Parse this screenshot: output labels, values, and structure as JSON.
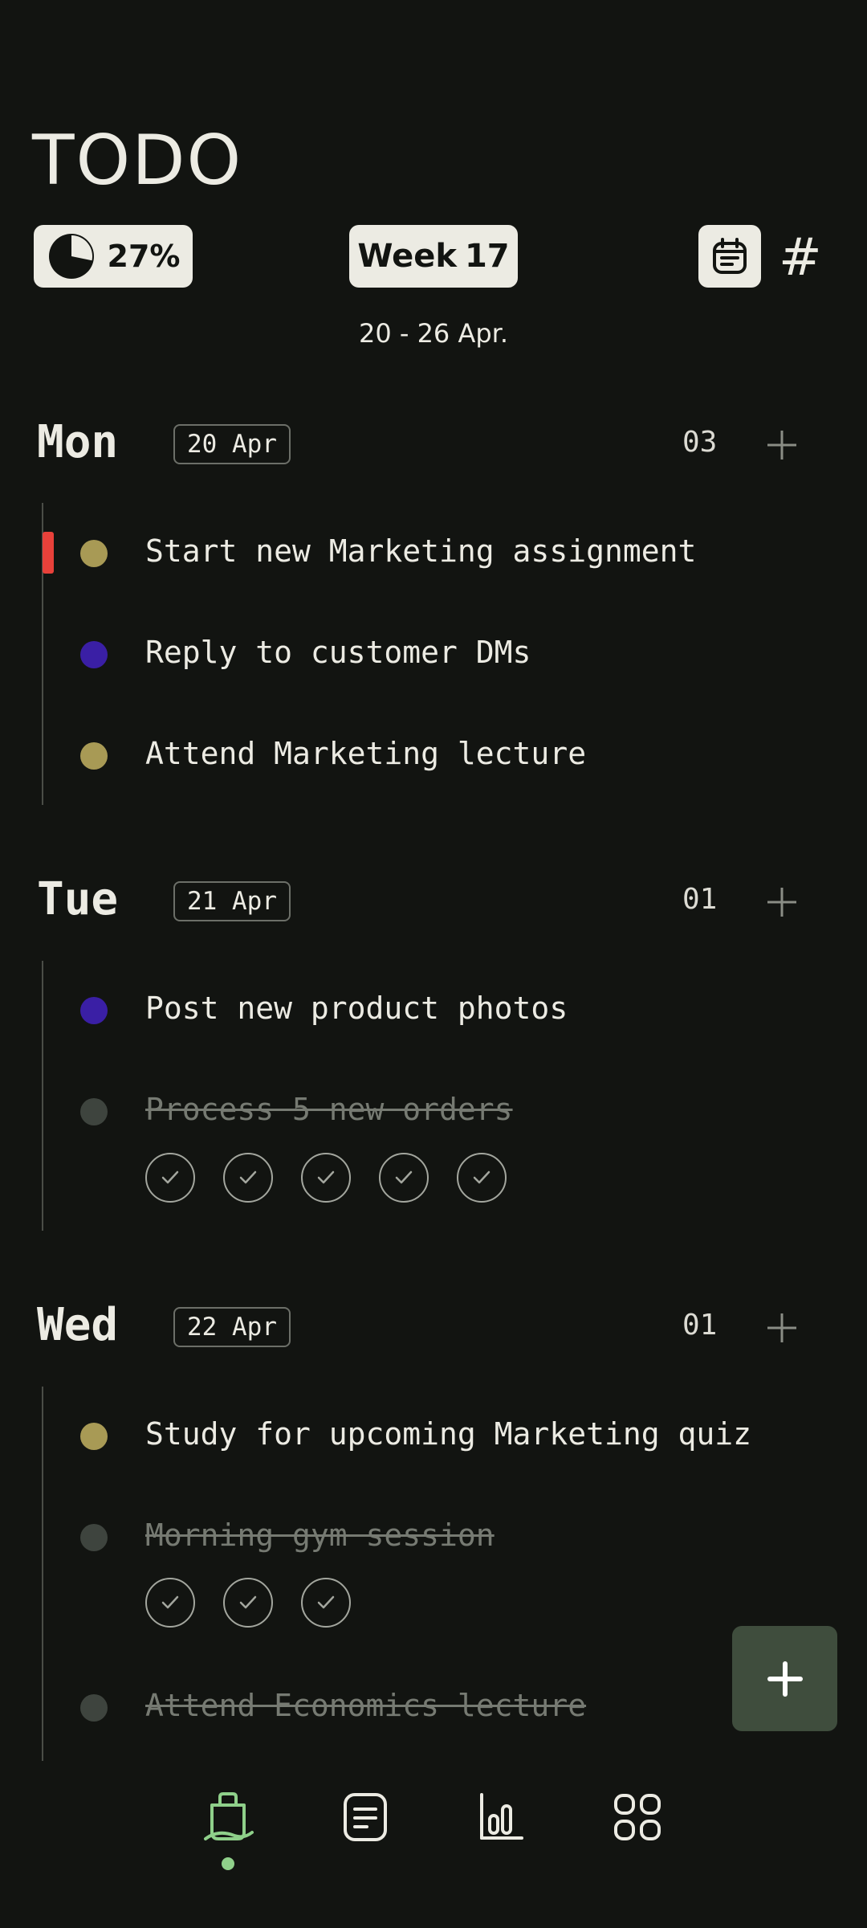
{
  "header": {
    "title": "TODO",
    "progress": "27%",
    "progress_fraction": 0.27,
    "week_label": "Week",
    "week_number": "17",
    "hash_label": "#",
    "range": "20 - 26 Apr."
  },
  "days": [
    {
      "name": "Mon",
      "date": "20 Apr",
      "count": "03",
      "tasks": [
        {
          "label": "Start new Marketing assignment",
          "color": "#a89a55",
          "done": false,
          "priority": true
        },
        {
          "label": "Reply to customer DMs",
          "color": "#3a1fa5",
          "done": false
        },
        {
          "label": "Attend Marketing lecture",
          "color": "#a89a55",
          "done": false
        }
      ]
    },
    {
      "name": "Tue",
      "date": "21 Apr",
      "count": "01",
      "tasks": [
        {
          "label": "Post new product photos",
          "color": "#3a1fa5",
          "done": false
        },
        {
          "label": "Process 5 new orders",
          "color": "#3e443e",
          "done": true,
          "checks": 5
        }
      ]
    },
    {
      "name": "Wed",
      "date": "22 Apr",
      "count": "01",
      "tasks": [
        {
          "label": "Study for upcoming Marketing quiz",
          "color": "#a89a55",
          "done": false
        },
        {
          "label": "Morning gym session",
          "color": "#3e443e",
          "done": true,
          "checks": 3
        },
        {
          "label": "Attend Economics lecture",
          "color": "#3e443e",
          "done": true
        }
      ]
    }
  ],
  "colors": {
    "background": "#121411",
    "accent_green": "#8fd08a",
    "fab": "#3f4d3d",
    "priority_red": "#e8413a"
  },
  "nav": [
    {
      "icon": "clipboard-icon",
      "active": true
    },
    {
      "icon": "notes-icon",
      "active": false
    },
    {
      "icon": "bar-chart-icon",
      "active": false
    },
    {
      "icon": "grid-icon",
      "active": false
    }
  ],
  "fab_icon": "plus-icon"
}
